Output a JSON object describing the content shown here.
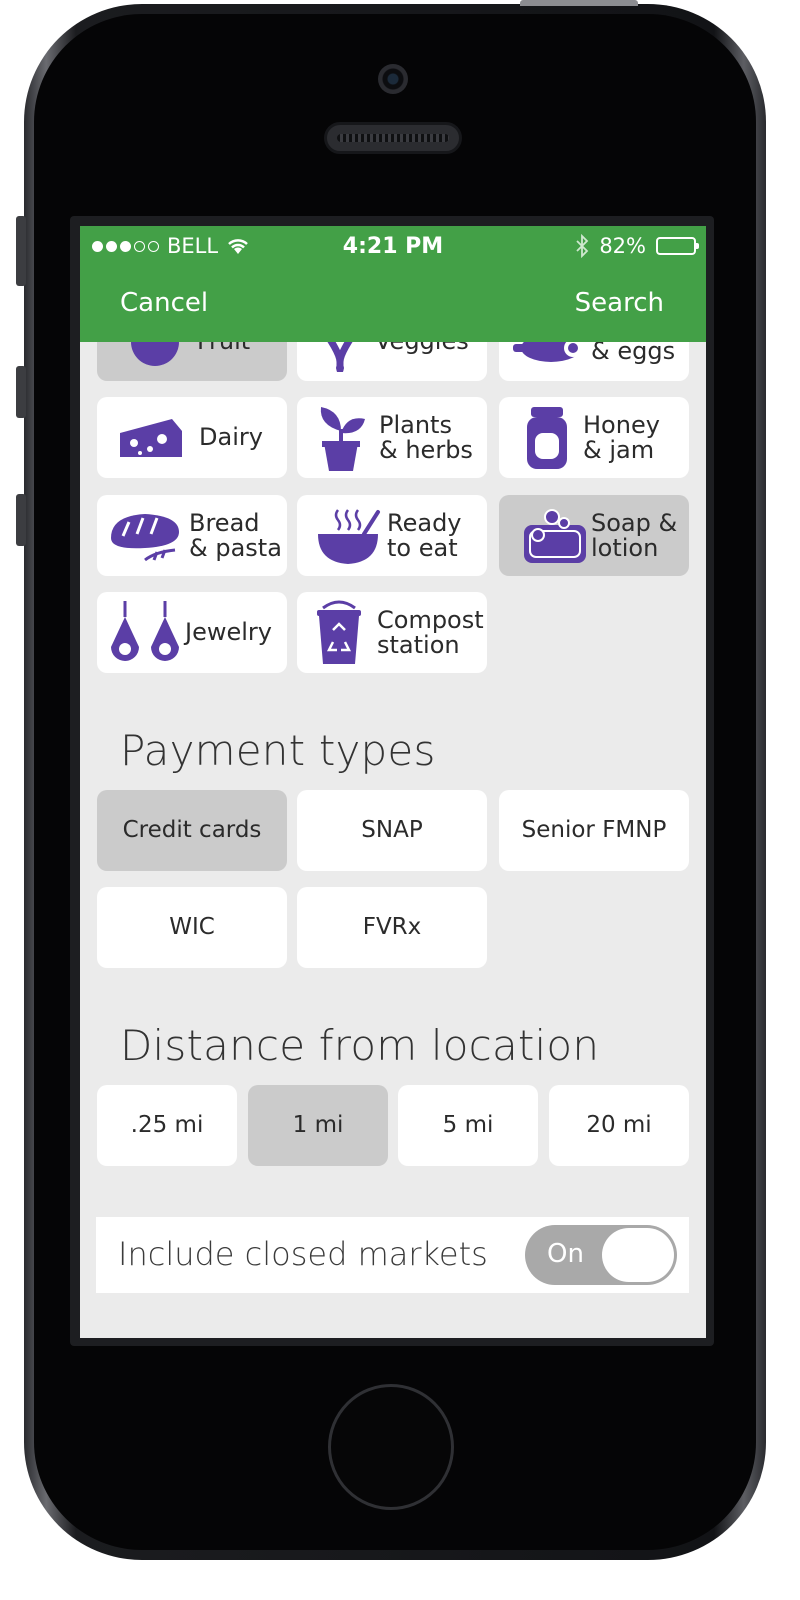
{
  "status_bar": {
    "carrier": "BELL",
    "time": "4:21 PM",
    "battery": "82%",
    "battery_level": 0.82,
    "signal_strength": 3
  },
  "nav": {
    "cancel_label": "Cancel",
    "search_label": "Search"
  },
  "categories": [
    {
      "label": "Fruit",
      "icon": "fruit-icon",
      "selected": true
    },
    {
      "label": "Veggies",
      "icon": "veggies-icon",
      "selected": false
    },
    {
      "label": "& eggs",
      "icon": "meat-icon",
      "selected": false
    },
    {
      "label": "Dairy",
      "icon": "cheese-icon",
      "selected": false
    },
    {
      "label": "Plants\n& herbs",
      "icon": "plant-icon",
      "selected": false
    },
    {
      "label": "Honey\n& jam",
      "icon": "jar-icon",
      "selected": false
    },
    {
      "label": "Bread\n& pasta",
      "icon": "bread-icon",
      "selected": false
    },
    {
      "label": "Ready\nto eat",
      "icon": "bowl-icon",
      "selected": false
    },
    {
      "label": "Soap &\nlotion",
      "icon": "soap-icon",
      "selected": true
    },
    {
      "label": "Jewelry",
      "icon": "earrings-icon",
      "selected": false
    },
    {
      "label": "Compost\nstation",
      "icon": "compost-icon",
      "selected": false
    }
  ],
  "payment": {
    "title": "Payment types",
    "options": [
      {
        "label": "Credit cards",
        "selected": true
      },
      {
        "label": "SNAP",
        "selected": false
      },
      {
        "label": "Senior FMNP",
        "selected": false
      },
      {
        "label": "WIC",
        "selected": false
      },
      {
        "label": "FVRx",
        "selected": false
      }
    ]
  },
  "distance": {
    "title": "Distance from location",
    "options": [
      {
        "label": ".25 mi",
        "selected": false
      },
      {
        "label": "1 mi",
        "selected": true
      },
      {
        "label": "5 mi",
        "selected": false
      },
      {
        "label": "20 mi",
        "selected": false
      }
    ]
  },
  "closed_markets": {
    "label": "Include closed markets",
    "toggle_label": "On",
    "value": true
  },
  "colors": {
    "header_green": "#43a047",
    "icon_purple": "#5b3ea6",
    "selected_gray": "#cbcbcb",
    "background": "#ebebeb"
  }
}
